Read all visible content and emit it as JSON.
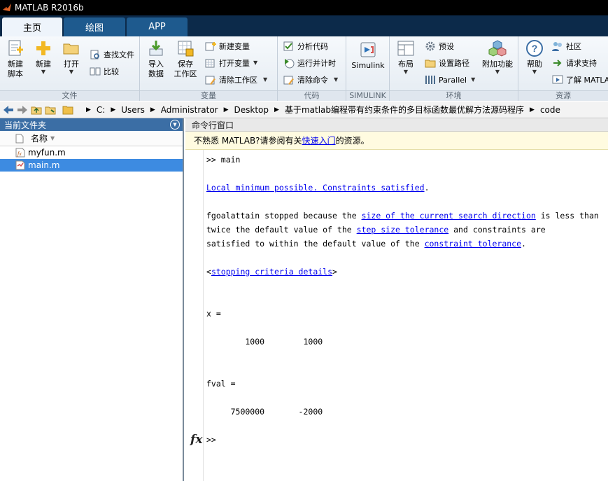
{
  "window": {
    "title": "MATLAB R2016b"
  },
  "tabs": [
    {
      "label": "主页"
    },
    {
      "label": "绘图"
    },
    {
      "label": "APP"
    }
  ],
  "ribbon": {
    "file": {
      "label": "文件",
      "new_script": "新建\n脚本",
      "new": "新建",
      "open": "打开",
      "find_files": "查找文件",
      "compare": "比较"
    },
    "variable": {
      "label": "变量",
      "import": "导入\n数据",
      "save_workspace": "保存\n工作区",
      "new_variable": "新建变量",
      "open_variable": "打开变量",
      "clear_workspace": "清除工作区"
    },
    "code": {
      "label": "代码",
      "analyze": "分析代码",
      "run_time": "运行并计时",
      "clear_commands": "清除命令"
    },
    "simulink": {
      "label": "SIMULINK",
      "simulink": "Simulink"
    },
    "environment": {
      "label": "环境",
      "layout": "布局",
      "preferences": "预设",
      "set_path": "设置路径",
      "parallel": "Parallel",
      "addons": "附加功能"
    },
    "resources": {
      "label": "资源",
      "help": "帮助",
      "community": "社区",
      "support": "请求支持",
      "learn": "了解 MATLAB"
    }
  },
  "address": {
    "crumbs": [
      "C:",
      "Users",
      "Administrator",
      "Desktop",
      "基于matlab编程带有约束条件的多目标函数最优解方法源码程序",
      "code"
    ]
  },
  "current_folder": {
    "title": "当前文件夹",
    "column_name": "名称",
    "files": [
      {
        "name": "myfun.m"
      },
      {
        "name": "main.m"
      }
    ]
  },
  "command_window": {
    "title": "命令行窗口",
    "notice_prefix": "不熟悉 MATLAB?请参阅有关",
    "notice_link": "快速入门",
    "notice_suffix": "的资源。",
    "prompt_line": ">> main",
    "local_min": "Local minimum possible. Constraints satisfied",
    "local_min_suffix": ".",
    "msg1_a": "fgoalattain stopped because the ",
    "msg1_link": "size of the current search direction",
    "msg1_b": " is less than",
    "msg2_a": "twice the default value of the ",
    "msg2_link": "step size tolerance",
    "msg2_b": " and constraints are",
    "msg3_a": "satisfied to within the default value of the ",
    "msg3_link": "constraint tolerance",
    "msg3_b": ".",
    "criteria_open": "<",
    "criteria_link": "stopping criteria details",
    "criteria_close": ">",
    "x_label": "x =",
    "x_values": "        1000        1000",
    "fval_label": "fval =",
    "fval_values": "     7500000       -2000",
    "empty_prompt": ">>",
    "fx_label": "fx"
  }
}
